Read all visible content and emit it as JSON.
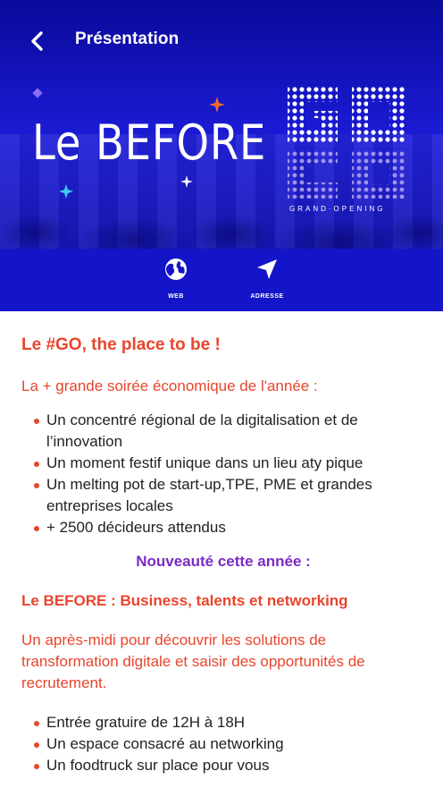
{
  "topbar": {
    "title": "Présentation"
  },
  "hero": {
    "logo_text": "Le BEFORE",
    "go_text": "GO",
    "go_subtitle": "GRAND·OPENING",
    "colors": {
      "background": "#1414b8",
      "accent_orange": "#f26a2e",
      "accent_cyan": "#3ec8f0",
      "accent_purple": "#8a6cf0"
    }
  },
  "actions": [
    {
      "label": "WEB",
      "icon": "globe-icon"
    },
    {
      "label": "ADRESSE",
      "icon": "navigation-arrow-icon"
    }
  ],
  "content": {
    "headline": "Le #GO, the place to be !",
    "intro": "La + grande soirée économique de l'année :",
    "bullets_1": [
      "Un concentré régional de la digitalisation et de l’innovation",
      "Un moment festif unique dans un lieu aty pique",
      "Un melting pot de start-up,TPE, PME et grandes entreprises locales",
      "+ 2500 décideurs attendus"
    ],
    "new_this_year": "Nouveauté cette année :",
    "subhead": "Le BEFORE : Business, talents et networking",
    "paragraph": "Un après-midi pour découvrir les solutions de transformation digitale et saisir des opportunités de recrutement.",
    "bullets_2": [
      "Entrée gratuire de 12H à 18H",
      "Un espace consacré au networking",
      "Un foodtruck sur place pour vous"
    ],
    "colors": {
      "text_red": "#e8452c",
      "text_dark": "#222222",
      "text_purple": "#7a2bc4"
    }
  }
}
